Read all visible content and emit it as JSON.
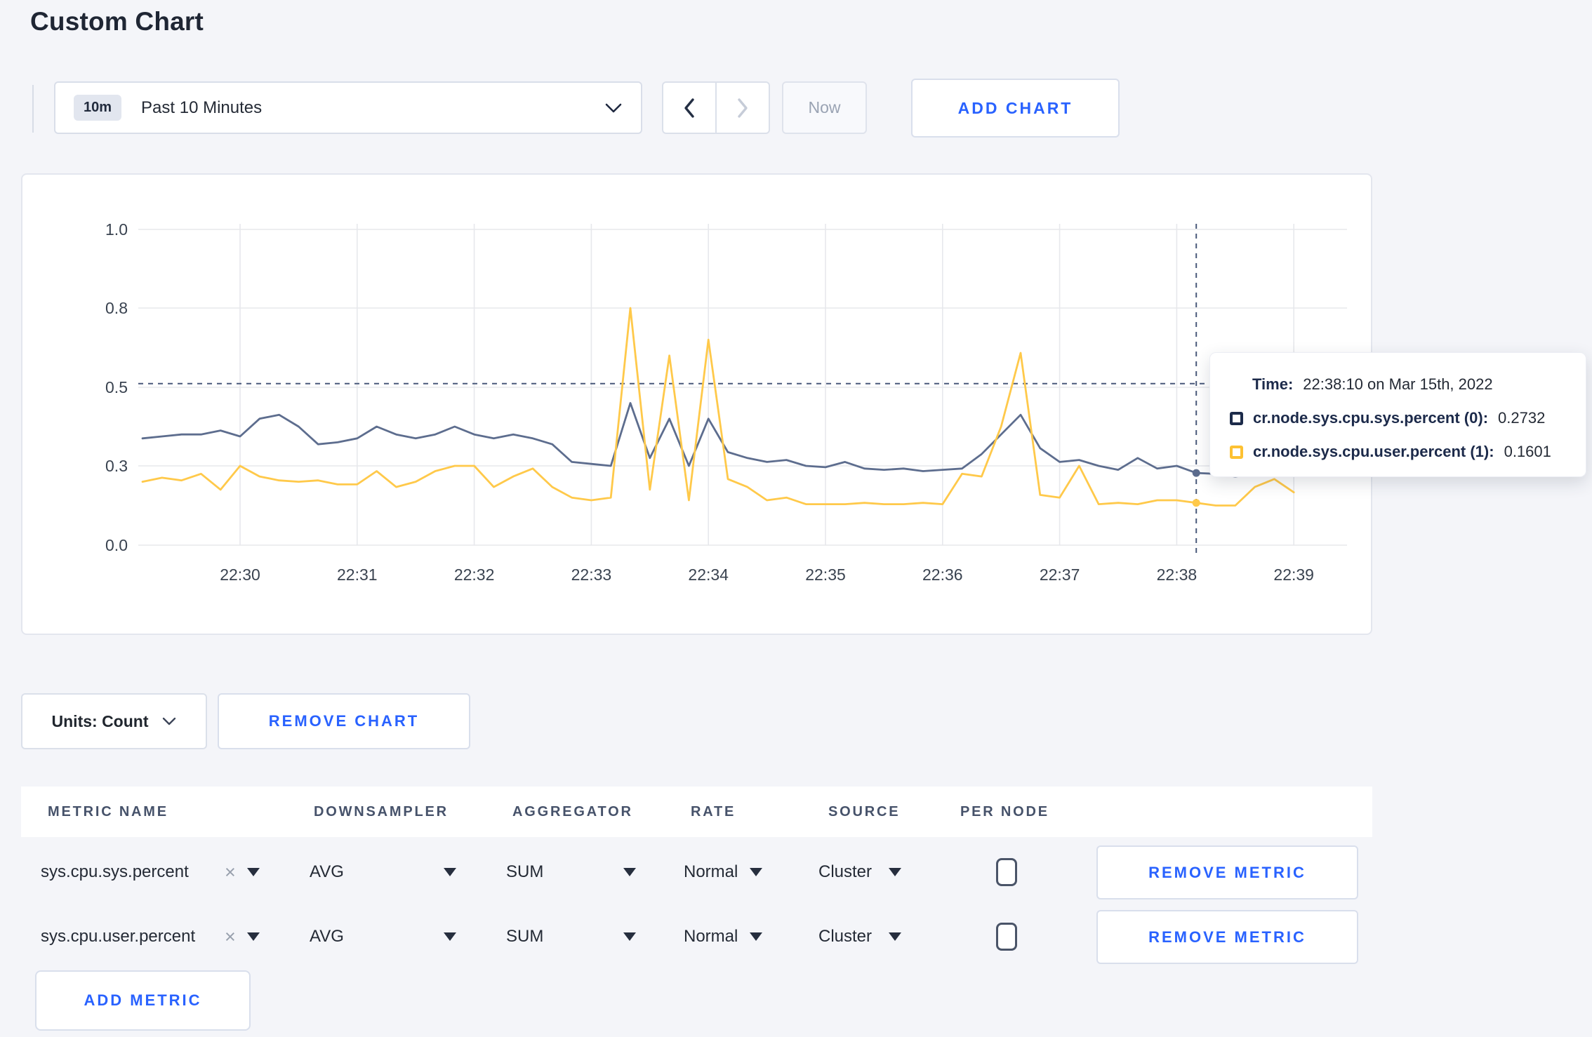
{
  "page": {
    "title": "Custom Chart"
  },
  "toolbar": {
    "time_badge": "10m",
    "time_label": "Past 10 Minutes",
    "now": "Now",
    "add_chart": "ADD CHART"
  },
  "chart_data": {
    "type": "line",
    "title": "",
    "xlabel": "",
    "ylabel": "",
    "ylim": [
      0,
      1
    ],
    "grid": true,
    "y_tick_labels": [
      "0.0",
      "0.3",
      "0.5",
      "0.8",
      "1.0"
    ],
    "y_tick_values": [
      0,
      0.3,
      0.5,
      0.8,
      1.0
    ],
    "x_tick_labels": [
      "22:30",
      "22:31",
      "22:32",
      "22:33",
      "22:34",
      "22:35",
      "22:36",
      "22:37",
      "22:38",
      "22:39"
    ],
    "x": [
      "22:29:10",
      "22:29:20",
      "22:29:30",
      "22:29:40",
      "22:29:50",
      "22:30:00",
      "22:30:10",
      "22:30:20",
      "22:30:30",
      "22:30:40",
      "22:30:50",
      "22:31:00",
      "22:31:10",
      "22:31:20",
      "22:31:30",
      "22:31:40",
      "22:31:50",
      "22:32:00",
      "22:32:10",
      "22:32:20",
      "22:32:30",
      "22:32:40",
      "22:32:50",
      "22:33:00",
      "22:33:10",
      "22:33:20",
      "22:33:30",
      "22:33:40",
      "22:33:50",
      "22:34:00",
      "22:34:10",
      "22:34:20",
      "22:34:30",
      "22:34:40",
      "22:34:50",
      "22:35:00",
      "22:35:10",
      "22:35:20",
      "22:35:30",
      "22:35:40",
      "22:35:50",
      "22:36:00",
      "22:36:10",
      "22:36:20",
      "22:36:30",
      "22:36:40",
      "22:36:50",
      "22:37:00",
      "22:37:10",
      "22:37:20",
      "22:37:30",
      "22:37:40",
      "22:37:50",
      "22:38:00",
      "22:38:10",
      "22:38:20",
      "22:38:30",
      "22:38:40",
      "22:38:50",
      "22:39:00"
    ],
    "series": [
      {
        "name": "cr.node.sys.cpu.sys.percent (0)",
        "color": "#5d6d8e",
        "values": [
          0.37,
          0.375,
          0.38,
          0.38,
          0.39,
          0.375,
          0.42,
          0.43,
          0.4,
          0.355,
          0.36,
          0.37,
          0.4,
          0.38,
          0.37,
          0.38,
          0.4,
          0.38,
          0.37,
          0.38,
          0.37,
          0.355,
          0.31,
          0.305,
          0.3,
          0.46,
          0.32,
          0.42,
          0.3,
          0.42,
          0.335,
          0.32,
          0.31,
          0.315,
          0.3,
          0.295,
          0.31,
          0.29,
          0.285,
          0.29,
          0.28,
          0.285,
          0.29,
          0.33,
          0.38,
          0.43,
          0.345,
          0.31,
          0.315,
          0.3,
          0.285,
          0.32,
          0.29,
          0.3,
          0.2732,
          0.27,
          0.26,
          0.27,
          0.28,
          0.3
        ]
      },
      {
        "name": "cr.node.sys.cpu.user.percent (1)",
        "color": "#ffc94a",
        "values": [
          0.24,
          0.255,
          0.245,
          0.27,
          0.21,
          0.3,
          0.26,
          0.245,
          0.24,
          0.245,
          0.23,
          0.23,
          0.28,
          0.22,
          0.24,
          0.28,
          0.3,
          0.3,
          0.22,
          0.26,
          0.29,
          0.22,
          0.18,
          0.17,
          0.18,
          0.8,
          0.21,
          0.62,
          0.17,
          0.68,
          0.25,
          0.22,
          0.17,
          0.18,
          0.155,
          0.155,
          0.155,
          0.16,
          0.155,
          0.155,
          0.16,
          0.155,
          0.27,
          0.26,
          0.4,
          0.63,
          0.19,
          0.18,
          0.3,
          0.155,
          0.16,
          0.155,
          0.17,
          0.17,
          0.1601,
          0.15,
          0.15,
          0.22,
          0.25,
          0.2
        ]
      }
    ],
    "crosshair": {
      "time": "22:38:10",
      "hline_value": 0.514,
      "color": "#49597a"
    },
    "legend_position": "tooltip",
    "grid_color": "#e7e8ec"
  },
  "tooltip": {
    "time_label": "Time:",
    "time_value": "22:38:10 on Mar 15th, 2022",
    "rows": [
      {
        "label": "cr.node.sys.cpu.sys.percent (0):",
        "value": "0.2732",
        "swatch": "#1c2b4a"
      },
      {
        "label": "cr.node.sys.cpu.user.percent (1):",
        "value": "0.1601",
        "swatch": "#fdc132"
      }
    ]
  },
  "chart_controls": {
    "units": "Units: Count",
    "remove_chart": "REMOVE CHART"
  },
  "metrics_table": {
    "headers": [
      "METRIC NAME",
      "DOWNSAMPLER",
      "AGGREGATOR",
      "RATE",
      "SOURCE",
      "PER NODE"
    ],
    "rows": [
      {
        "metric": "sys.cpu.sys.percent",
        "downsampler": "AVG",
        "aggregator": "SUM",
        "rate": "Normal",
        "source": "Cluster",
        "per_node": false,
        "remove": "REMOVE METRIC"
      },
      {
        "metric": "sys.cpu.user.percent",
        "downsampler": "AVG",
        "aggregator": "SUM",
        "rate": "Normal",
        "source": "Cluster",
        "per_node": false,
        "remove": "REMOVE METRIC"
      }
    ],
    "add_metric": "ADD METRIC"
  }
}
